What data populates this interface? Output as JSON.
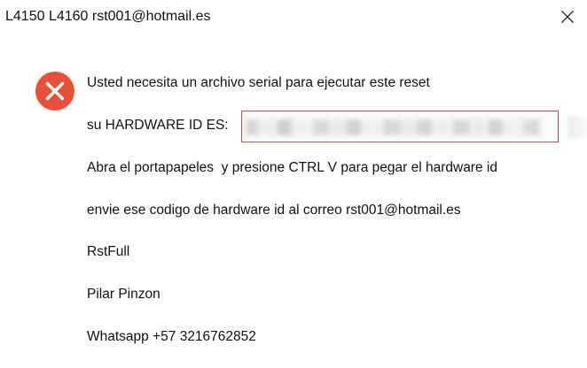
{
  "window": {
    "title": "L4150 L4160 rst001@hotmail.es",
    "close_icon": "close-icon"
  },
  "icon": {
    "name": "error-icon",
    "color": "#e8503a"
  },
  "message": {
    "line1": "Usted necesita un archivo serial para ejecutar este reset",
    "hardware_label": "su HARDWARE ID ES:",
    "line3": "Abra el portapapeles  y presione CTRL V para pegar el hardware id",
    "line4": "envie ese codigo de hardware id al correo rst001@hotmail.es",
    "line5": "RstFull",
    "line6": "Pilar Pinzon",
    "line7": "Whatsapp +57 3216762852"
  },
  "colors": {
    "highlight_border": "#c0504d"
  }
}
